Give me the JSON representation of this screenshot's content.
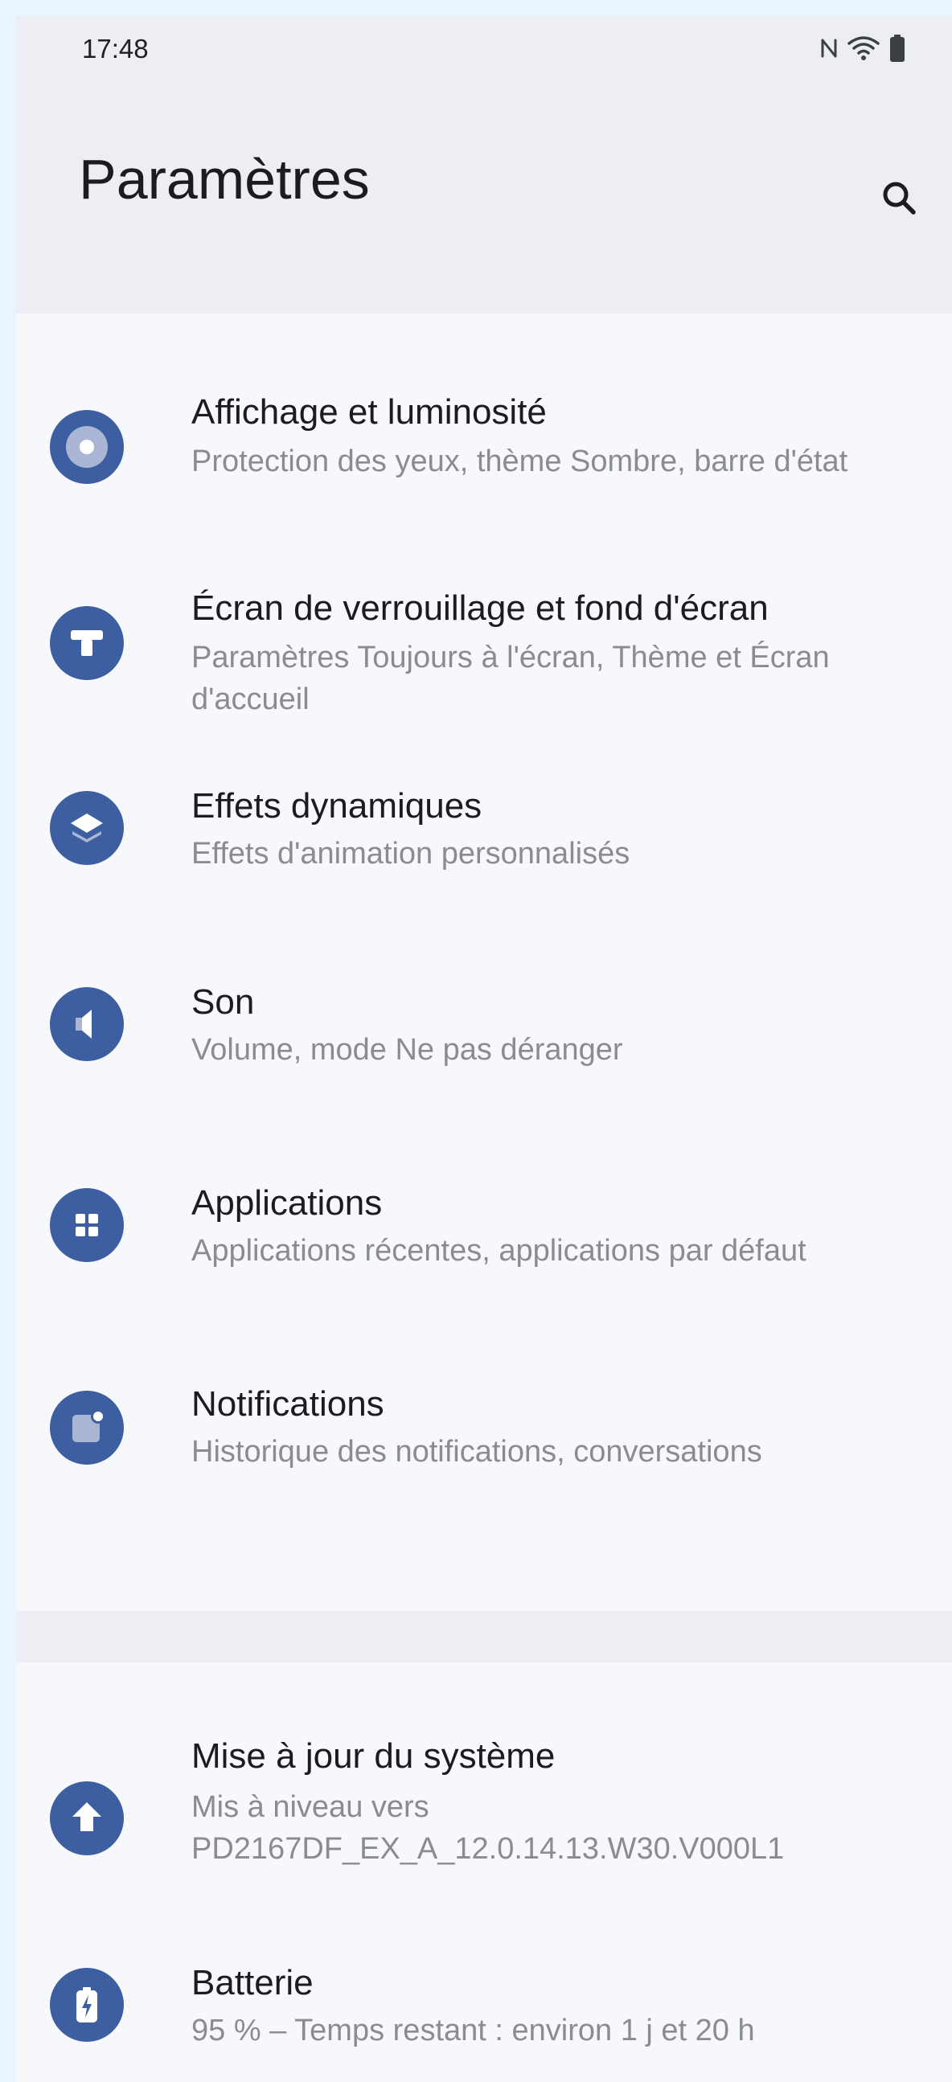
{
  "status_bar": {
    "time": "17:48",
    "icons": [
      "nfc-icon",
      "wifi-icon",
      "battery-icon"
    ]
  },
  "header": {
    "title": "Paramètres",
    "search_icon": "search-icon"
  },
  "colors": {
    "icon_circle": "#3d5ea0",
    "card_background": "#f7f8fc",
    "page_background": "#eceef3",
    "subtitle_text": "#8a8c91"
  },
  "groups": [
    {
      "items": [
        {
          "icon": "display-brightness-icon",
          "title": "Affichage et luminosité",
          "subtitle": "Protection des yeux, thème Sombre, barre d'état"
        },
        {
          "icon": "lock-screen-wallpaper-icon",
          "title": "Écran de verrouillage et fond d'écran",
          "subtitle": "Paramètres Toujours à l'écran, Thème et Écran d'accueil"
        },
        {
          "icon": "dynamic-effects-icon",
          "title": "Effets dynamiques",
          "subtitle": "Effets d'animation personnalisés"
        },
        {
          "icon": "sound-icon",
          "title": "Son",
          "subtitle": "Volume, mode Ne pas déranger"
        },
        {
          "icon": "apps-icon",
          "title": "Applications",
          "subtitle": "Applications récentes, applications par défaut"
        },
        {
          "icon": "notifications-icon",
          "title": "Notifications",
          "subtitle": "Historique des notifications, conversations"
        }
      ]
    },
    {
      "items": [
        {
          "icon": "system-update-icon",
          "title": "Mise à jour du système",
          "subtitle": "Mis à niveau vers PD2167DF_EX_A_12.0.14.13.W30.V000L1"
        },
        {
          "icon": "battery-charging-icon",
          "title": "Batterie",
          "subtitle": "95 % – Temps restant : environ 1 j et 20 h"
        }
      ]
    }
  ]
}
